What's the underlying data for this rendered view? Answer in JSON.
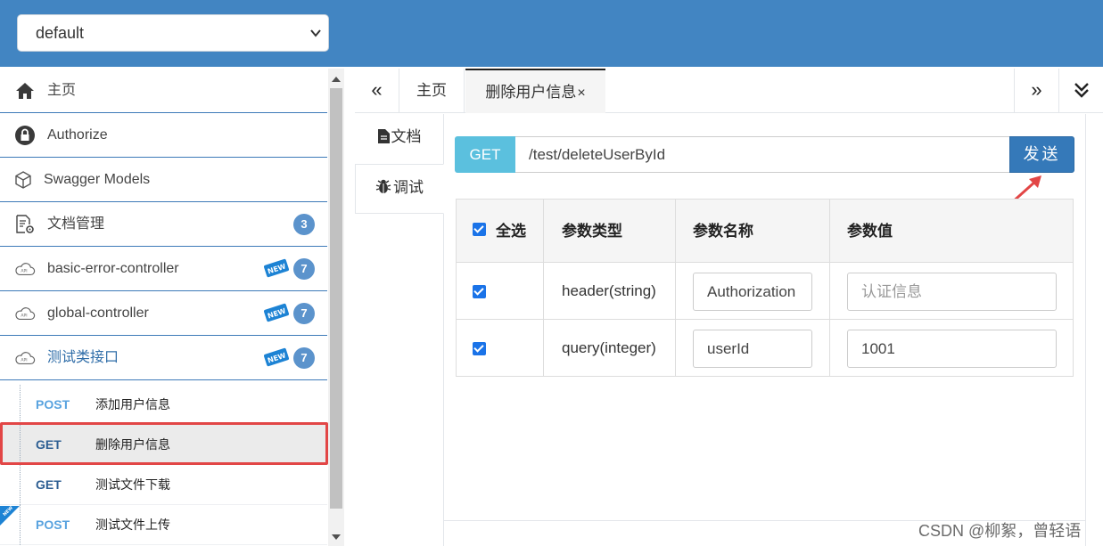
{
  "header": {
    "group_select": "default"
  },
  "sidebar": {
    "menu": [
      {
        "label": "主页",
        "icon": "home-icon"
      },
      {
        "label": "Authorize",
        "icon": "lock-icon"
      },
      {
        "label": "Swagger Models",
        "icon": "cube-icon"
      },
      {
        "label": "文档管理",
        "icon": "document-gear-icon",
        "count": "3"
      },
      {
        "label": "basic-error-controller",
        "icon": "cloud-api-icon",
        "count": "7",
        "badge": "NEW"
      },
      {
        "label": "global-controller",
        "icon": "cloud-api-icon",
        "count": "7",
        "badge": "NEW"
      },
      {
        "label": "测试类接口",
        "icon": "cloud-api-icon",
        "count": "7",
        "badge": "NEW"
      }
    ],
    "apis": [
      {
        "method": "POST",
        "name": "添加用户信息"
      },
      {
        "method": "GET",
        "name": "删除用户信息"
      },
      {
        "method": "GET",
        "name": "测试文件下载"
      },
      {
        "method": "POST",
        "name": "测试文件上传"
      }
    ]
  },
  "tabs": {
    "home": "主页",
    "current": "删除用户信息",
    "close": "×",
    "nav_left": "«",
    "nav_right": "»"
  },
  "side_tabs": {
    "doc": "文档",
    "debug": "调试"
  },
  "request": {
    "method": "GET",
    "url": "/test/deleteUserById",
    "send_label": "发送"
  },
  "params": {
    "headers": {
      "select_all": "全选",
      "type": "参数类型",
      "name": "参数名称",
      "value": "参数值"
    },
    "rows": [
      {
        "type": "header(string)",
        "name": "Authorization",
        "value": "",
        "value_placeholder": "认证信息"
      },
      {
        "type": "query(integer)",
        "name": "userId",
        "value": "1001",
        "value_placeholder": ""
      }
    ]
  },
  "watermark": "CSDN @柳絮，曾轻语"
}
